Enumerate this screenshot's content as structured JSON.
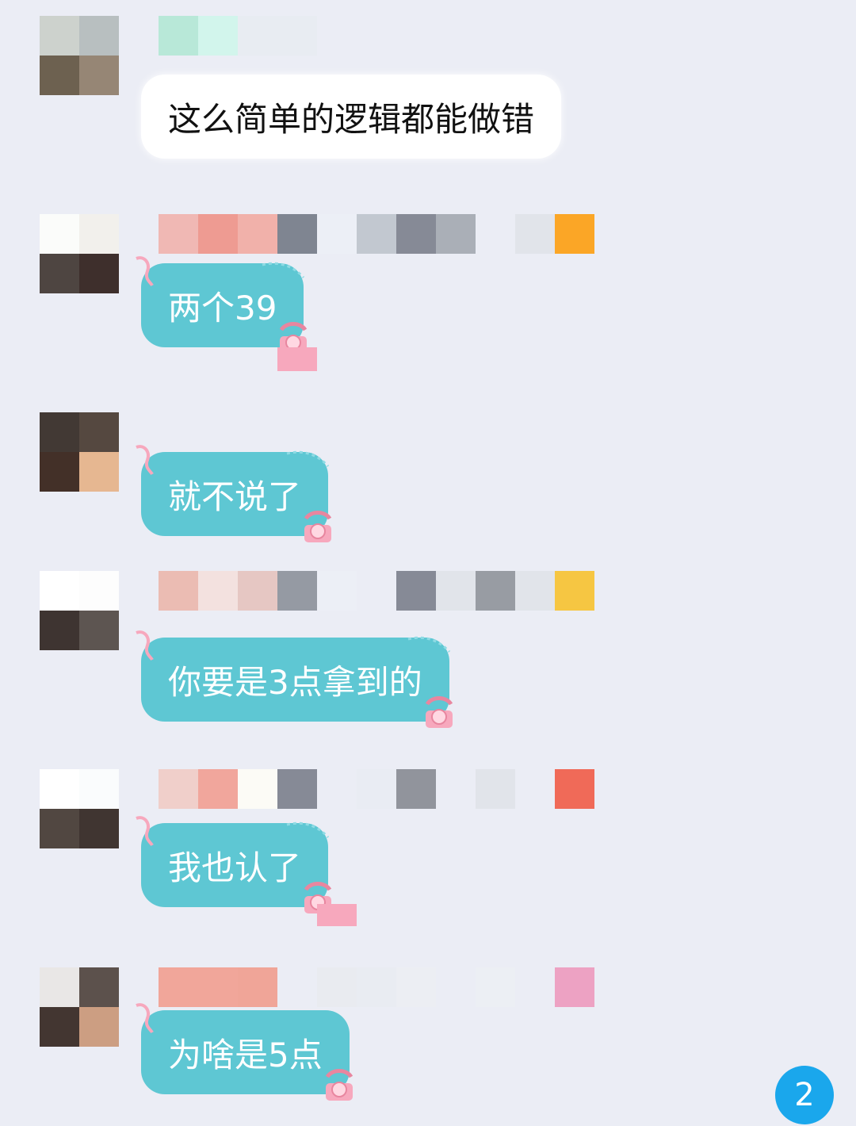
{
  "messages": [
    {
      "text": "这么简单的逻辑都能做错",
      "bubble_style": "white",
      "avatar_colors": [
        "#cdd2cd",
        "#b8bfc0",
        "#6d6150",
        "#968675"
      ],
      "name_colors": [
        "#b8e8d8",
        "#d2f5ec",
        "#e8ecf2",
        "#e8ecf2"
      ]
    },
    {
      "text": "两个39",
      "bubble_style": "teal",
      "avatar_colors": [
        "#fbfcfa",
        "#f2f0ec",
        "#4e4541",
        "#3e2f2c"
      ],
      "name_colors": [
        "#f0b8b4",
        "#ee9b92",
        "#f1b1aa",
        "#7f8591",
        "#eceff6",
        "#c2c8d0",
        "#868a96",
        "#aaafb7",
        "#ebedf5",
        "#e1e4ea",
        "#fba626"
      ]
    },
    {
      "text": "就不说了",
      "bubble_style": "teal",
      "avatar_colors": [
        "#423934",
        "#554840",
        "#433028",
        "#e6b791"
      ],
      "name_colors": []
    },
    {
      "text": "你要是3点拿到的",
      "bubble_style": "teal",
      "avatar_colors": [
        "#ffffff",
        "#fdfdfd",
        "#3e3431",
        "#5d5551"
      ],
      "name_colors": [
        "#ebbcb3",
        "#f3e1df",
        "#e6c7c3",
        "#959aa3",
        "#eceff6",
        "#ebedf5",
        "#868a96",
        "#e1e4ea",
        "#989ca3",
        "#e1e4ea",
        "#f6c642"
      ]
    },
    {
      "text": "我也认了",
      "bubble_style": "teal",
      "avatar_colors": [
        "#ffffff",
        "#fafcfd",
        "#514741",
        "#403531"
      ],
      "name_colors": [
        "#f0cfca",
        "#f1a69c",
        "#fcfbf6",
        "#868a96",
        "#ebedf5",
        "#e9ecf3",
        "#91949c",
        "#ebedf5",
        "#e1e4ea",
        "#ebedf5",
        "#f06a58"
      ]
    },
    {
      "text": "为啥是5点",
      "bubble_style": "teal",
      "avatar_colors": [
        "#e9e7e6",
        "#5c514c",
        "#433631",
        "#cc9e82"
      ],
      "name_colors": [
        "#f1a69a",
        "#f1a69a",
        "#f0a598",
        "#ebedf5",
        "#e9ebf0",
        "#e9ecf2",
        "#eceef3",
        "#ebedf5",
        "#eceff4",
        "#ebedf5",
        "#eda2c3"
      ]
    }
  ],
  "unread_badge": "2",
  "colors": {
    "background": "#ebedf5",
    "bubble_teal": "#5ec7d3",
    "badge_blue": "#1aa7ec",
    "phone_pink": "#f7a8bd"
  }
}
